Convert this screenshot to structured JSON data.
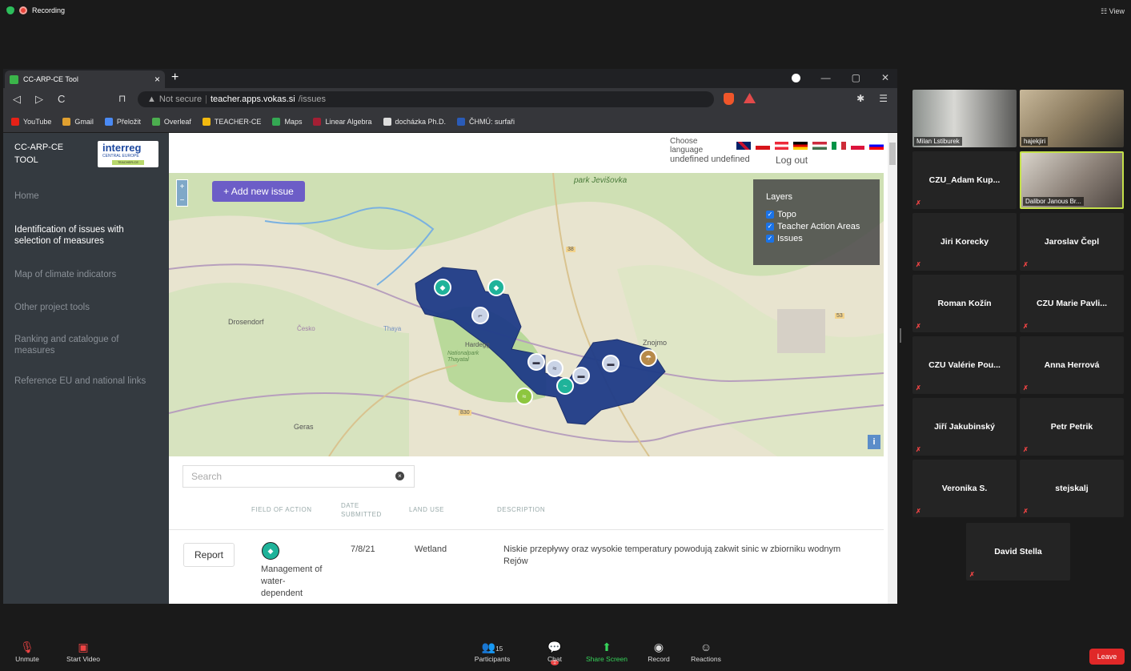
{
  "zoom": {
    "recording_label": "Recording",
    "view_label": "View",
    "bottom": {
      "unmute": "Unmute",
      "start_video": "Start Video",
      "participants": "Participants",
      "participant_count": "15",
      "chat": "Chat",
      "chat_badge": "1",
      "share_screen": "Share Screen",
      "record": "Record",
      "reactions": "Reactions",
      "leave": "Leave"
    },
    "video_tiles": [
      {
        "name": "Milan Lstiburek"
      },
      {
        "name": "hajekjiri"
      },
      {
        "name": "Dalibor Janous Br..."
      }
    ],
    "participants": [
      "CZU_Adam Kup...",
      "Jiri Korecky",
      "Jaroslav Čepl",
      "Roman Kožín",
      "CZU Marie Pavli...",
      "CZU Valérie Pou...",
      "Anna Herrová",
      "Jiří Jakubinský",
      "Petr Petrik",
      "Veronika S.",
      "stejskalj",
      "David Stella"
    ]
  },
  "browser": {
    "tab_title": "CC-ARP-CE Tool",
    "url_warning": "Not secure",
    "url_host": "teacher.apps.vokas.si",
    "url_path": "/issues",
    "bookmarks": [
      {
        "label": "YouTube",
        "color": "#e62117"
      },
      {
        "label": "Gmail",
        "color": "#e0a030"
      },
      {
        "label": "Přeložit",
        "color": "#4a8af4"
      },
      {
        "label": "Overleaf",
        "color": "#4cae4f"
      },
      {
        "label": "TEACHER-CE",
        "color": "#f2b90f"
      },
      {
        "label": "Maps",
        "color": "#34a853"
      },
      {
        "label": "Linear Algebra",
        "color": "#a31f34"
      },
      {
        "label": "docházka Ph.D.",
        "color": "#dddddd"
      },
      {
        "label": "ČHMÚ: surfaři",
        "color": "#2a5bb7"
      }
    ]
  },
  "app": {
    "brand_line1": "CC-ARP-CE",
    "brand_line2": "TOOL",
    "logo_text": "interreg",
    "logo_sub": "CENTRAL EUROPE",
    "logo_tag": "TEACHER-CE",
    "nav": [
      {
        "label": "Home",
        "active": false
      },
      {
        "label": "Identification of issues with selection of measures",
        "active": true
      },
      {
        "label": "Map of climate indicators",
        "active": false
      },
      {
        "label": "Other project tools",
        "active": false
      },
      {
        "label": "Ranking and catalogue of measures",
        "active": false
      },
      {
        "label": "Reference EU and national links",
        "active": false
      }
    ],
    "choose_language": "Choose language",
    "user_line": "undefined undefined",
    "logout": "Log out",
    "map": {
      "add_issue": "+ Add new issue",
      "zoom_in": "+",
      "zoom_out": "−",
      "layers_title": "Layers",
      "layers": [
        "Topo",
        "Teacher Action Areas",
        "Issues"
      ],
      "info": "i",
      "labels": [
        "park Jevišovka",
        "Drosendorf",
        "Česko",
        "Thaya",
        "Hardegg",
        "Nationalpark Thayatal",
        "Geras",
        "Znojmo",
        "38",
        "53",
        "830",
        "Česko"
      ]
    },
    "search_placeholder": "Search",
    "table": {
      "headers": [
        "FIELD OF ACTION",
        "DATE SUBMITTED",
        "LAND USE",
        "DESCRIPTION"
      ],
      "rows": [
        {
          "action": "Report",
          "field": "Management of water-dependent",
          "date": "7/8/21",
          "land_use": "Wetland",
          "description": "Niskie przepływy oraz wysokie temperatury powodują zakwit sinic w zbiorniku wodnym Rejów"
        }
      ]
    }
  }
}
